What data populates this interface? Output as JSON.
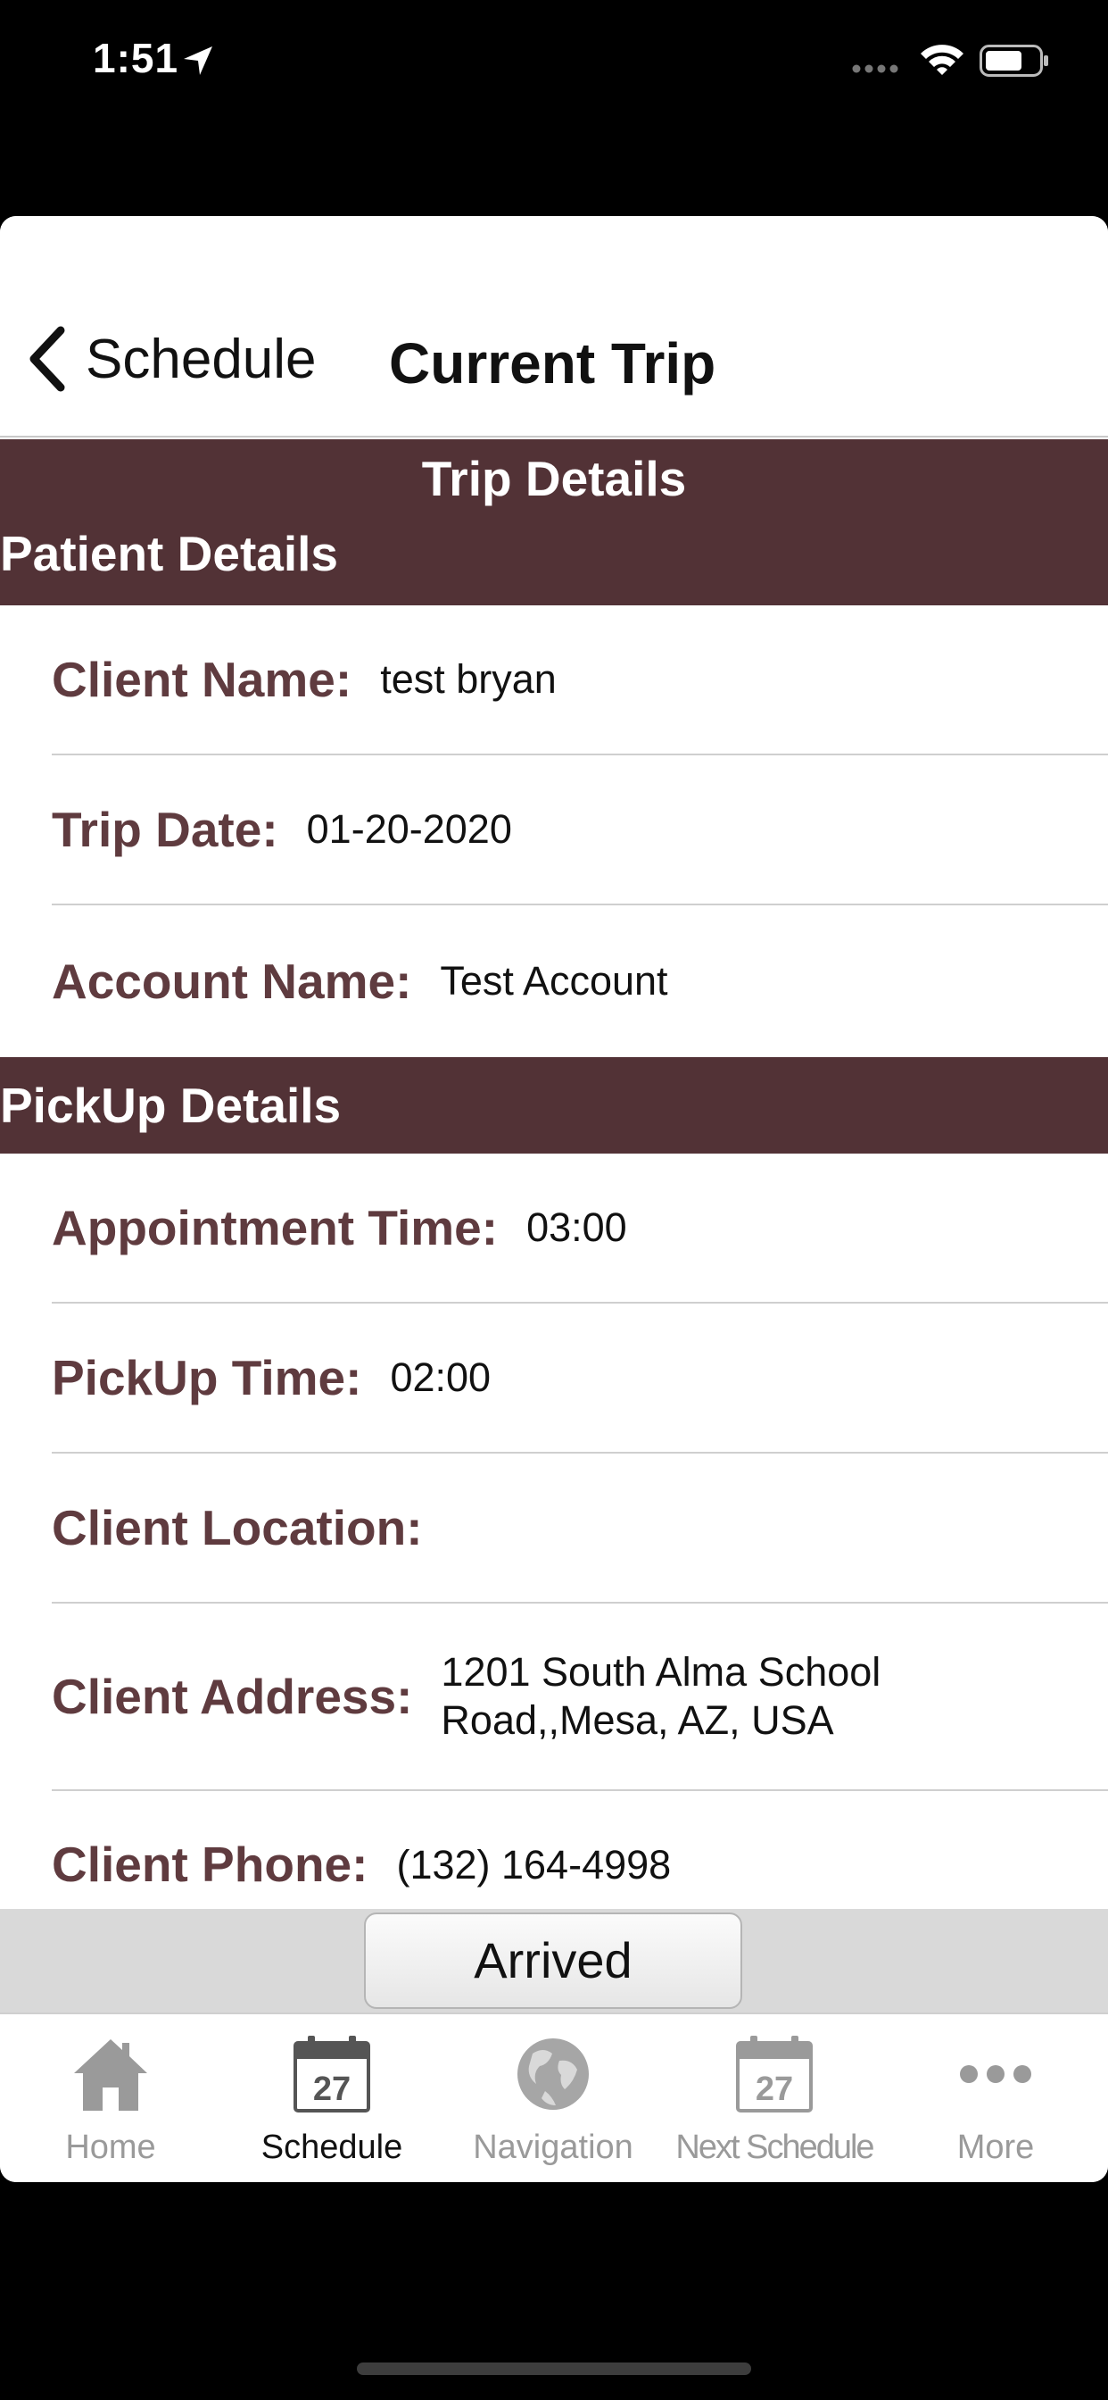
{
  "status_bar": {
    "time": "1:51"
  },
  "nav": {
    "back_label": "Schedule",
    "title": "Current Trip"
  },
  "banner": {
    "title": "Trip Details"
  },
  "patient_section": {
    "title": "Patient Details",
    "rows": [
      {
        "label": "Client Name:",
        "value": "test bryan"
      },
      {
        "label": "Trip Date:",
        "value": "01-20-2020"
      },
      {
        "label": "Account Name:",
        "value": "Test Account"
      }
    ]
  },
  "pickup_section": {
    "title": "PickUp Details",
    "rows": [
      {
        "label": "Appointment Time:",
        "value": "03:00"
      },
      {
        "label": "PickUp Time:",
        "value": "02:00"
      },
      {
        "label": "Client Location:",
        "value": ""
      },
      {
        "label": "Client Address:",
        "value_line1": "1201 South Alma School",
        "value_line2": "Road,,Mesa, AZ, USA"
      },
      {
        "label": "Client Phone:",
        "value": "(132) 164-4998"
      }
    ]
  },
  "action": {
    "arrived_label": "Arrived"
  },
  "tabs": [
    {
      "label": "Home",
      "icon": "house-icon"
    },
    {
      "label": "Schedule",
      "icon": "calendar-icon",
      "icon_text": "27",
      "active": true
    },
    {
      "label": "Navigation",
      "icon": "globe-icon"
    },
    {
      "label": "Next Schedule",
      "icon": "calendar-icon",
      "icon_text": "27"
    },
    {
      "label": "More",
      "icon": "more-icon"
    }
  ],
  "colors": {
    "header_bg": "#523236",
    "label": "#5f3b3f",
    "inactive_tab": "#9a9a9a"
  }
}
